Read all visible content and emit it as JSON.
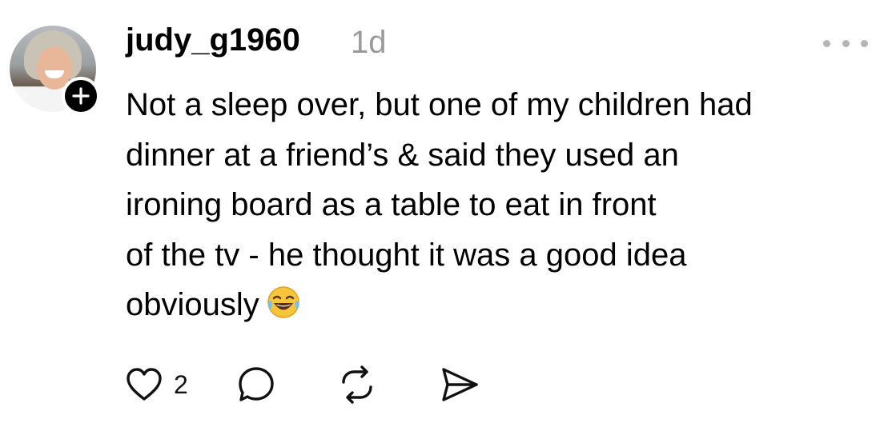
{
  "post": {
    "username": "judy_g1960",
    "time": "1d",
    "lines": [
      "Not a sleep over, but one of my children had",
      "dinner at a friend’s & said they used an",
      "ironing board as a table to eat in front",
      "of the tv - he thought it was a good idea",
      "obviously"
    ],
    "emoji": "face-with-tears-of-joy"
  },
  "actions": {
    "like_icon": "heart-icon",
    "like_count": "2",
    "comment_icon": "comment-bubble-icon",
    "repost_icon": "repost-icon",
    "share_icon": "send-icon"
  },
  "icons": {
    "avatar": "avatar",
    "follow": "plus-icon",
    "more": "more-options-icon"
  },
  "colors": {
    "text": "#000000",
    "muted": "#9a9a9a",
    "dots": "#b5b5b5",
    "background": "#ffffff"
  }
}
